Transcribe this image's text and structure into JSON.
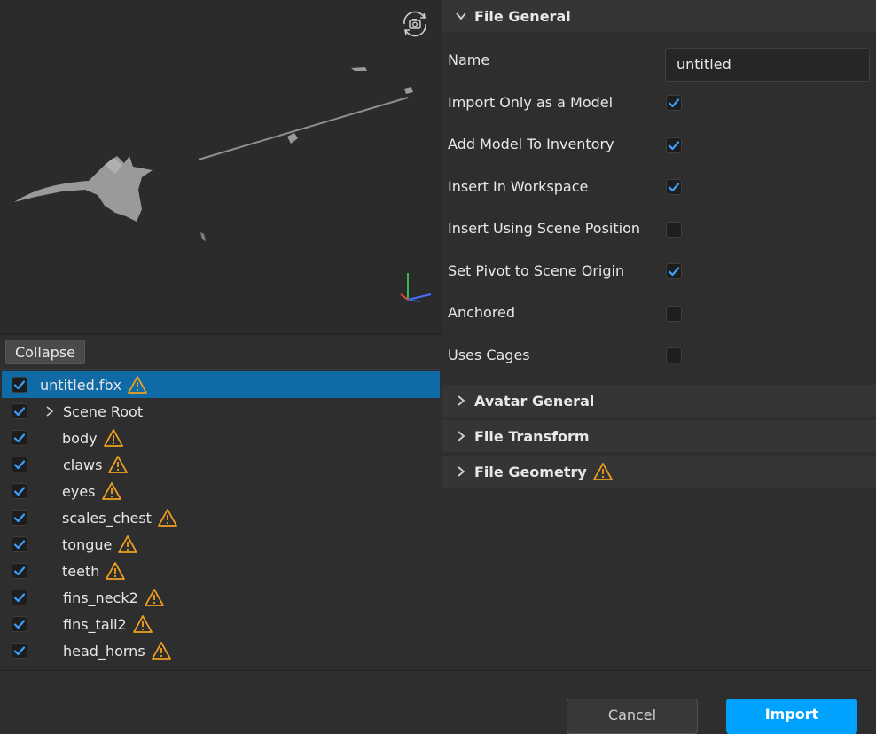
{
  "tree": {
    "collapse_label": "Collapse",
    "root_label": "untitled.fbx",
    "scene_root_label": "Scene Root",
    "items": [
      {
        "label": "body"
      },
      {
        "label": "claws"
      },
      {
        "label": "eyes"
      },
      {
        "label": "scales_chest"
      },
      {
        "label": "tongue"
      },
      {
        "label": "teeth"
      },
      {
        "label": "fins_neck2"
      },
      {
        "label": "fins_tail2"
      },
      {
        "label": "head_horns"
      }
    ]
  },
  "file_general": {
    "title": "File General",
    "name_label": "Name",
    "name_value": "untitled",
    "props": [
      {
        "label": "Import Only as a Model",
        "checked": true
      },
      {
        "label": "Add Model To Inventory",
        "checked": true
      },
      {
        "label": "Insert In Workspace",
        "checked": true
      },
      {
        "label": "Insert Using Scene Position",
        "checked": false
      },
      {
        "label": "Set Pivot to Scene Origin",
        "checked": true
      },
      {
        "label": "Anchored",
        "checked": false
      },
      {
        "label": "Uses Cages",
        "checked": false
      }
    ]
  },
  "sections": {
    "avatar_general": "Avatar General",
    "file_transform": "File Transform",
    "file_geometry": "File Geometry"
  },
  "footer": {
    "cancel_label": "Cancel",
    "import_label": "Import"
  },
  "colors": {
    "accent": "#00a2ff",
    "selection": "#0f6aa6",
    "check": "#3aa0ff",
    "warning": "#f0a020"
  }
}
